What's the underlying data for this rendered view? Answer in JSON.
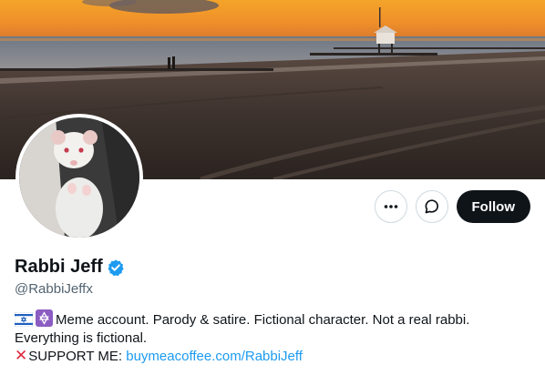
{
  "banner": {
    "alt": "Sunset beach photo with pier and lifeguard tower"
  },
  "avatar": {
    "alt": "White rat standing upright"
  },
  "actions": {
    "more_icon": "more-horizontal-icon",
    "message_icon": "message-bubble-icon",
    "follow_label": "Follow"
  },
  "profile": {
    "display_name": "Rabbi Jeff",
    "verified_icon": "verified-badge-icon",
    "handle": "@RabbiJeffx"
  },
  "bio": {
    "line1_icons": [
      "israel-flag-icon",
      "star-of-david-icon"
    ],
    "line1": "Meme account. Parody & satire. Fictional character. Not a real rabbi.",
    "line2": "Everything is fictional.",
    "support_icon": "red-x-icon",
    "support_label": "SUPPORT ME: ",
    "support_link": "buymeacoffee.com/RabbiJeff"
  },
  "colors": {
    "accent": "#1d9bf0",
    "follow_bg": "#0f1419",
    "secondary_text": "#536471",
    "border": "#cfd9de"
  }
}
